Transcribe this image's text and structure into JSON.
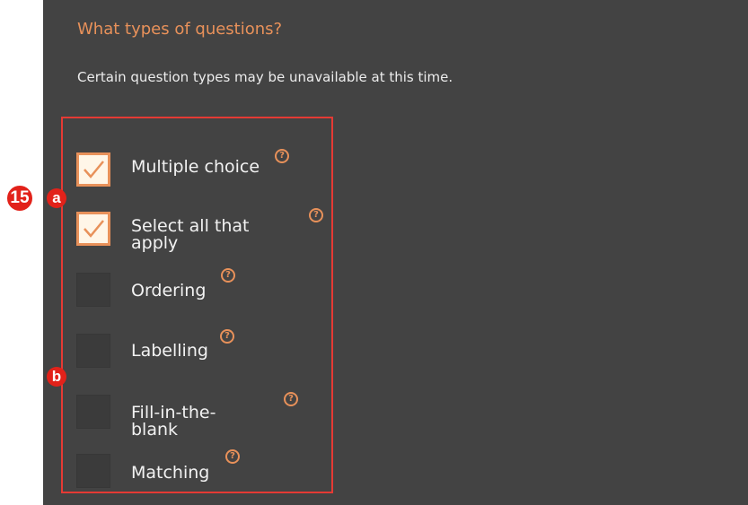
{
  "heading": "What types of questions?",
  "subtext": "Certain question types may be unavailable at this time.",
  "help_symbol": "?",
  "annotations": {
    "step": "15",
    "a": "a",
    "b": "b"
  },
  "options": [
    {
      "label": "Multiple choice",
      "checked": true
    },
    {
      "label": "Select all that apply",
      "checked": true
    },
    {
      "label": "Ordering",
      "checked": false
    },
    {
      "label": "Labelling",
      "checked": false
    },
    {
      "label": "Fill-in-the-blank",
      "checked": false
    },
    {
      "label": "Matching",
      "checked": false
    }
  ],
  "colors": {
    "panel": "#434343",
    "accent": "#e8915a",
    "annotation_red": "#e2221a"
  }
}
